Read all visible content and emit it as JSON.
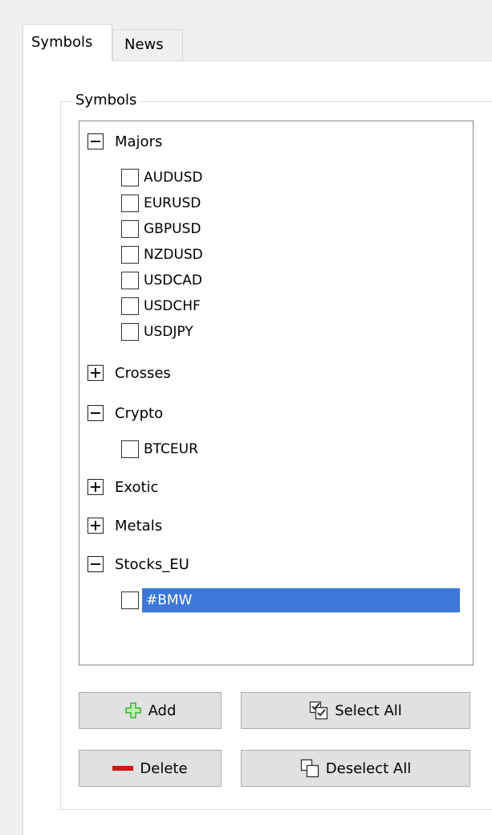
{
  "tabs": [
    {
      "label": "Symbols",
      "active": true
    },
    {
      "label": "News",
      "active": false
    }
  ],
  "group": {
    "title": "Symbols"
  },
  "tree": {
    "categories": [
      {
        "label": "Majors",
        "expanded": true,
        "symbols": [
          "AUDUSD",
          "EURUSD",
          "GBPUSD",
          "NZDUSD",
          "USDCAD",
          "USDCHF",
          "USDJPY"
        ]
      },
      {
        "label": "Crosses",
        "expanded": false
      },
      {
        "label": "Crypto",
        "expanded": true,
        "symbols": [
          "BTCEUR"
        ]
      },
      {
        "label": "Exotic",
        "expanded": false
      },
      {
        "label": "Metals",
        "expanded": false
      },
      {
        "label": "Stocks_EU",
        "expanded": true,
        "symbols": [
          "#BMW"
        ]
      }
    ],
    "selected_symbol": "#BMW"
  },
  "buttons": {
    "add": {
      "label": "Add",
      "icon": "plus-icon",
      "color": "#3cb43c"
    },
    "select_all": {
      "label": "Select All",
      "icon": "checked-boxes-icon"
    },
    "delete": {
      "label": "Delete",
      "icon": "minus-icon",
      "color": "#d01818"
    },
    "deselect_all": {
      "label": "Deselect All",
      "icon": "unchecked-boxes-icon"
    }
  },
  "colors": {
    "selection": "#3d78d8",
    "panel": "#ffffff",
    "window": "#f0f0f0"
  }
}
